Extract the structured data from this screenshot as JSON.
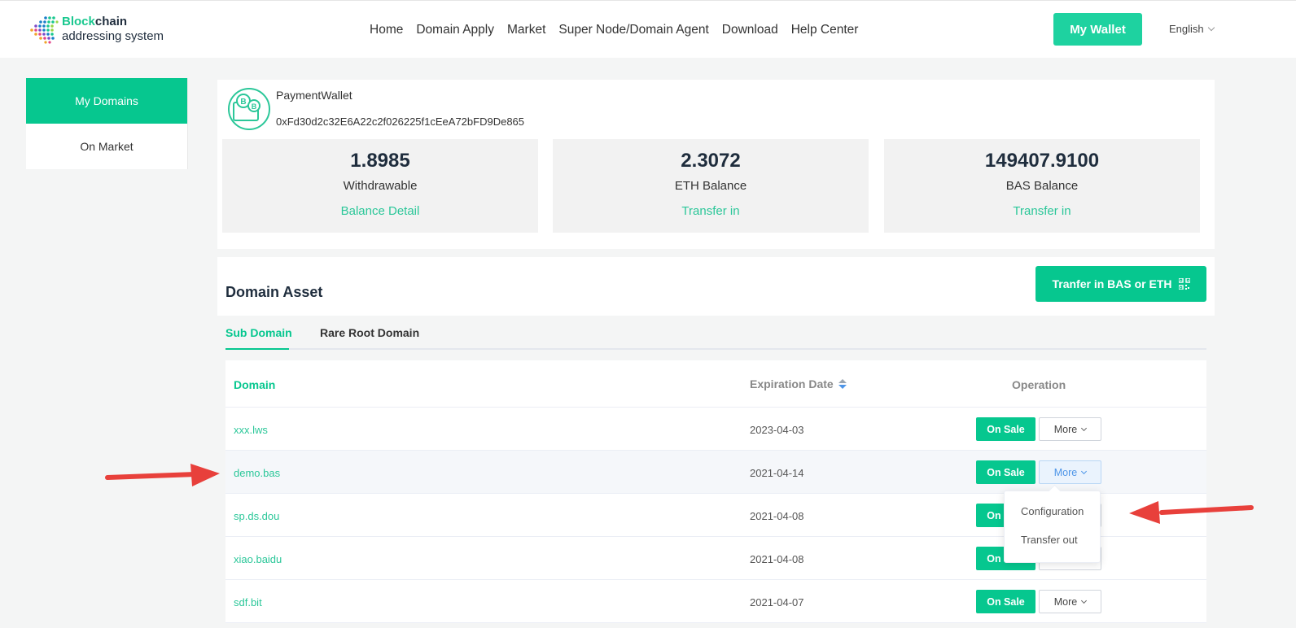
{
  "header": {
    "logo_line1_a": "Block",
    "logo_line1_b": "chain",
    "logo_line2": "addressing system",
    "nav": [
      "Home",
      "Domain Apply",
      "Market",
      "Super Node/Domain Agent",
      "Download",
      "Help Center"
    ],
    "wallet_button": "My Wallet",
    "language": "English"
  },
  "sidebar": {
    "items": [
      {
        "label": "My Domains",
        "active": true
      },
      {
        "label": "On Market",
        "active": false
      }
    ]
  },
  "wallet": {
    "name": "PaymentWallet",
    "address": "0xFd30d2c32E6A22c2f026225f1cEeA72bFD9De865",
    "stats": [
      {
        "value": "1.8985",
        "label": "Withdrawable",
        "link": "Balance Detail"
      },
      {
        "value": "2.3072",
        "label": "ETH Balance",
        "link": "Transfer in"
      },
      {
        "value": "149407.9100",
        "label": "BAS Balance",
        "link": "Transfer in"
      }
    ]
  },
  "asset": {
    "title": "Domain Asset",
    "transfer_button": "Tranfer in BAS or ETH",
    "tabs": [
      "Sub Domain",
      "Rare Root Domain"
    ],
    "columns": {
      "domain": "Domain",
      "expiration": "Expiration Date",
      "operation": "Operation"
    },
    "rows": [
      {
        "domain": "xxx.lws",
        "expiration": "2023-04-03"
      },
      {
        "domain": "demo.bas",
        "expiration": "2021-04-14"
      },
      {
        "domain": "sp.ds.dou",
        "expiration": "2021-04-08"
      },
      {
        "domain": "xiao.baidu",
        "expiration": "2021-04-08"
      },
      {
        "domain": "sdf.bit",
        "expiration": "2021-04-07"
      }
    ],
    "on_sale_label": "On Sale",
    "more_label": "More"
  },
  "dropdown": {
    "items": [
      "Configuration",
      "Transfer out"
    ]
  },
  "colors": {
    "accent": "#06c78f",
    "link": "#2bc799",
    "annotation_arrow": "#e8403b"
  }
}
